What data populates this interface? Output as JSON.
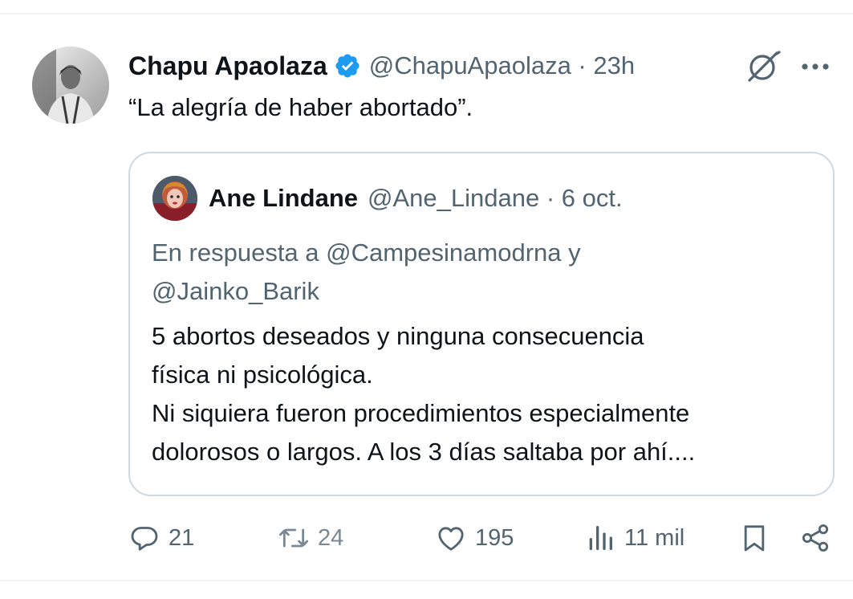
{
  "tweet": {
    "author_name": "Chapu Apaolaza",
    "handle_time": "@ChapuApaolaza · 23h",
    "text": "“La alegría de haber abortado”."
  },
  "quoted_tweet": {
    "author_name": "Ane Lindane",
    "handle_time": "@Ane_Lindane · 6 oct.",
    "reply_line_1": "En respuesta a @Campesinamodrna y",
    "reply_line_2": "@Jainko_Barik",
    "body_lines": [
      "5 abortos deseados y ninguna consecuencia",
      "física ni psicológica.",
      "Ni siquiera fueron procedimientos especialmente",
      "dolorosos o largos. A los 3 días saltaba por ahí...."
    ]
  },
  "actions": {
    "replies": "21",
    "retweets": "24",
    "likes": "195",
    "views": "11 mil"
  },
  "icons": {
    "verified": "verified-badge-icon",
    "grok": "grok-icon",
    "more": "more-icon",
    "reply": "reply-icon",
    "retweet": "retweet-icon",
    "like": "heart-icon",
    "views": "views-icon",
    "bookmark": "bookmark-icon",
    "share": "share-icon"
  },
  "colors": {
    "verified": "#1d9bf0",
    "text_primary": "#0f1419",
    "text_secondary": "#536471",
    "border": "#cfd9de"
  }
}
